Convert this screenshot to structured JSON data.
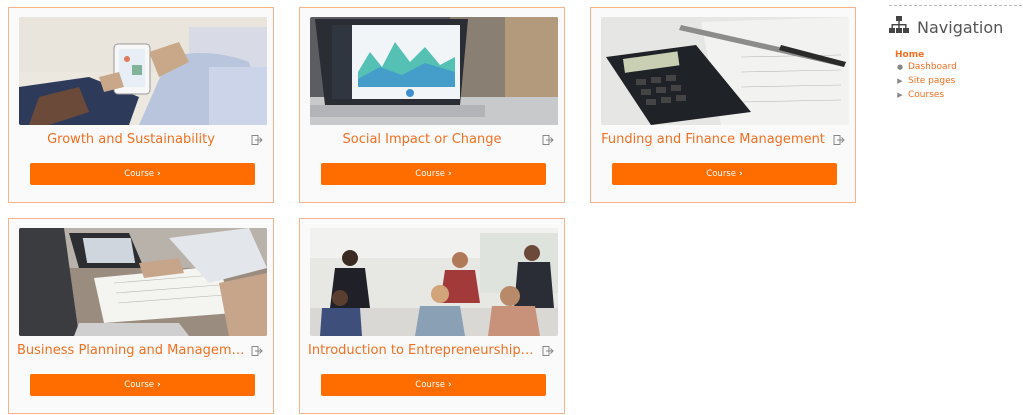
{
  "courses": [
    {
      "title": "Growth and Sustainability",
      "button": "Course"
    },
    {
      "title": "Social Impact or Change",
      "button": "Course"
    },
    {
      "title": "Funding and Finance Management",
      "button": "Course"
    },
    {
      "title": "Business Planning and Management",
      "button": "Course"
    },
    {
      "title": "Introduction to Entrepreneurship an...",
      "button": "Course"
    }
  ],
  "navigation": {
    "title": "Navigation",
    "home": "Home",
    "items": [
      {
        "label": "Dashboard",
        "bullet": "dot"
      },
      {
        "label": "Site pages",
        "bullet": "triangle"
      },
      {
        "label": "Courses",
        "bullet": "triangle"
      }
    ]
  },
  "colors": {
    "accent": "#ff6d00",
    "border": "#f7b38a",
    "text": "#f26f21"
  }
}
